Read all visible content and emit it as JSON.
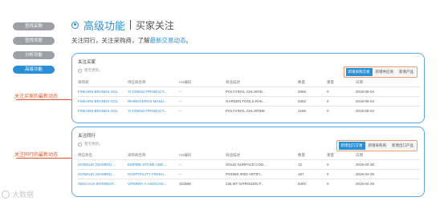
{
  "menu": [
    "查找采购",
    "查找邻居",
    "分析功能",
    "高级功能"
  ],
  "header": {
    "title": "高级功能",
    "subtitle": "买家关注",
    "desc_prefix": "关注同行，关注采购商，了解",
    "desc_highlight": "最新交易动态",
    "desc_suffix": "。"
  },
  "annotations": {
    "buyers": "关注买家的最新动态",
    "peers": "关注同行的最新动态"
  },
  "buyers_panel": {
    "title": "关注买家",
    "note": "暂无更新。",
    "tabs": [
      "新增采购交易",
      "新增供应商",
      "新增产品"
    ],
    "columns": [
      "采购商",
      "供应商名称",
      "HS编码",
      "商品描述",
      "数量",
      "重量",
      "日期"
    ],
    "rows": [
      [
        "FISKARS BRANDS GOL",
        "YI-CHENG PRODUCT...",
        "--",
        "POLYVINYL CHLORID...",
        "2056",
        "0",
        "2019-05-04"
      ],
      [
        "FISKARS BRANDS GOL",
        "RHINOCEROS MANU...",
        "--",
        "GARDEN TOOLS,RAK...",
        "2052",
        "0",
        "2019-05-04"
      ],
      [
        "FISKARS BRANDS GOL",
        "YI-CHENG PRODUCT...",
        "--",
        "POLYVINYL CHLORIDE",
        "2166",
        "0",
        "2019-05-04"
      ]
    ]
  },
  "peers_panel": {
    "title": "关注同行",
    "note": "暂无更新。",
    "tabs": [
      "新增出口交易",
      "新增采购商",
      "新增出口产品"
    ],
    "columns": [
      "供应商名",
      "采购商名称",
      "HS编码",
      "商品描述",
      "数量",
      "重量",
      "日期"
    ],
    "rows": [
      [
        "HONGLEI (XIAMEN) ...",
        "EMPIRE STONE AND ...",
        "--",
        "SOLID SURFACE COU...",
        "12",
        "0",
        "2019-04-30"
      ],
      [
        "HONGLEI (XIAMEN) ...",
        "HOSPITALITY FINISH...",
        "--",
        "PODMS 0002 ARTIFI...",
        "167",
        "0",
        "2019-04-25"
      ],
      [
        "XING HUA INTERNAT...",
        "VITERRA Y ASOCIAD...",
        "310590",
        "135 MT NITROGEN P...",
        "5400",
        "0",
        "2019-04-25"
      ]
    ]
  },
  "watermark": "大数据"
}
